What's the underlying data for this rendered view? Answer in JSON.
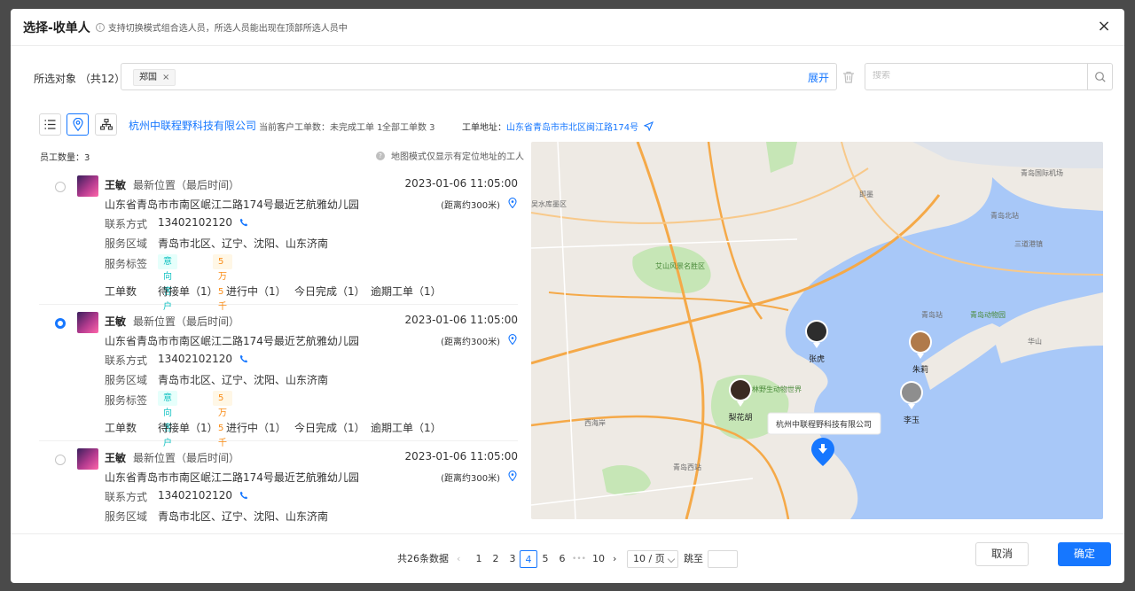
{
  "dialog": {
    "title": "选择-收单人",
    "hint": "支持切换模式组合选人员，所选人员能出现在顶部所选人员中",
    "close": "×"
  },
  "selection": {
    "label": "所选对象 （共12）",
    "tags": [
      {
        "label": "郑国",
        "remove": "×"
      }
    ],
    "expand": "展开",
    "search_placeholder": "搜索"
  },
  "toolbar": {
    "company": "杭州中联程野科技有限公司",
    "current_orders": "当前客户工单数：未完成工单 1",
    "all_orders": "全部工单数 3",
    "address_label": "工单地址：",
    "address": "山东省青岛市市北区闽江路174号"
  },
  "list": {
    "count_label": "员工数量：3",
    "map_tip": "地图模式仅显示有定位地址的工人",
    "field_contact": "联系方式",
    "field_area": "服务区域",
    "field_tags": "服务标签",
    "field_orders": "工单数",
    "items": [
      {
        "name": "王敏",
        "loc_label": "最新位置（最后时间）",
        "time": "2023-01-06 11:05:00",
        "address": "山东省青岛市市南区岷江二路174号最近艺航雅幼儿园",
        "distance": "(距离约300米)",
        "phone": "13402102120",
        "area": "青岛市北区、辽宁、沈阳、山东济南",
        "tag1": "意向客户",
        "tag2": "5万5千",
        "wo_pending": "待接单（1）",
        "wo_progress": "进行中（1）",
        "wo_today": "今日完成（1）",
        "wo_overdue": "逾期工单（1）",
        "selected": false
      },
      {
        "name": "王敏",
        "loc_label": "最新位置（最后时间）",
        "time": "2023-01-06 11:05:00",
        "address": "山东省青岛市市南区岷江二路174号最近艺航雅幼儿园",
        "distance": "(距离约300米)",
        "phone": "13402102120",
        "area": "青岛市北区、辽宁、沈阳、山东济南",
        "tag1": "意向客户",
        "tag2": "5万5千",
        "wo_pending": "待接单（1）",
        "wo_progress": "进行中（1）",
        "wo_today": "今日完成（1）",
        "wo_overdue": "逾期工单（1）",
        "selected": true
      },
      {
        "name": "王敏",
        "loc_label": "最新位置（最后时间）",
        "time": "2023-01-06 11:05:00",
        "address": "山东省青岛市市南区岷江二路174号最近艺航雅幼儿园",
        "distance": "(距离约300米)",
        "phone": "13402102120",
        "area": "青岛市北区、辽宁、沈阳、山东济南",
        "selected": false
      }
    ]
  },
  "map": {
    "markers": [
      "张虎",
      "朱莉",
      "李玉",
      "梨花胡"
    ],
    "company_popup": "杭州中联程野科技有限公司",
    "labels": [
      "吴水库墨区",
      "艾山风景名胜区",
      "青岛森林野生动物世界",
      "青岛西站",
      "青岛站",
      "青岛动物园",
      "华山",
      "青岛北站",
      "青岛国际机场",
      "三道港镇",
      "即墨",
      "西海岸"
    ]
  },
  "pagination": {
    "total": "共26条数据",
    "pages": [
      "1",
      "2",
      "3",
      "4",
      "5",
      "6",
      "10"
    ],
    "current": "4",
    "ellipsis": "•••",
    "page_size": "10 / 页",
    "jump_label": "跳至"
  },
  "actions": {
    "cancel": "取消",
    "ok": "确定"
  },
  "colors": {
    "primary": "#1677ff",
    "water": "#a8c8f8",
    "land": "#eeeae4",
    "park": "#c6e6b6",
    "road": "#f5a948"
  }
}
